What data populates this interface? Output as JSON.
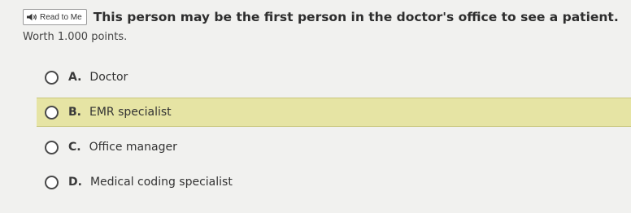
{
  "read_button": {
    "label": "Read to Me",
    "icon": "speaker-icon"
  },
  "question": {
    "text": "This person may be the first person in the doctor's office to see a patient."
  },
  "worth": "Worth 1.000 points.",
  "options": [
    {
      "letter": "A.",
      "text": "Doctor",
      "selected": false
    },
    {
      "letter": "B.",
      "text": "EMR specialist",
      "selected": true
    },
    {
      "letter": "C.",
      "text": "Office manager",
      "selected": false
    },
    {
      "letter": "D.",
      "text": "Medical coding specialist",
      "selected": false
    }
  ],
  "colors": {
    "highlight": "#e6e4a4",
    "background": "#f1f1ef"
  }
}
